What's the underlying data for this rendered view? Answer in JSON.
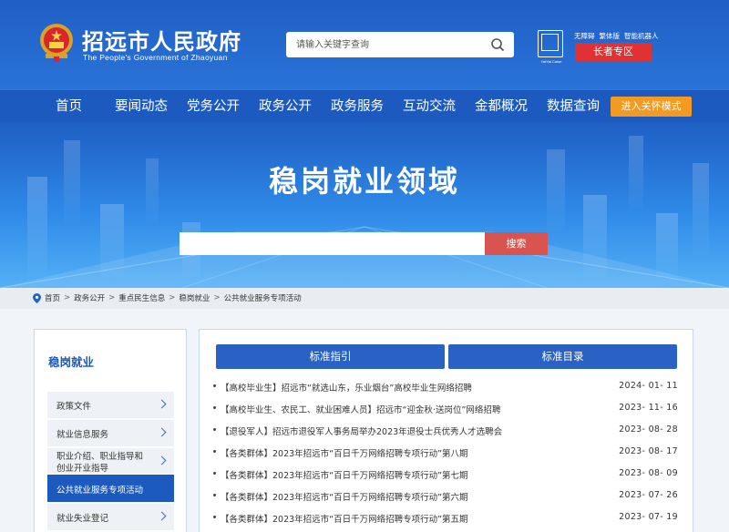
{
  "header": {
    "title": "招远市人民政府",
    "subtitle": "The People's Government of Zhaoyuan",
    "search_placeholder": "请输入关键字查询",
    "links": [
      "无障碍",
      "繁体版",
      "智能机器人"
    ],
    "elder_zone": "长者专区",
    "badge_caption": "YatYat Catse"
  },
  "nav": {
    "items": [
      "首页",
      "要闻动态",
      "党务公开",
      "政务公开",
      "政务服务",
      "互动交流",
      "金都概况",
      "数据查询"
    ],
    "care_mode": "进入关怀模式"
  },
  "banner": {
    "title": "稳岗就业领域",
    "search_button": "搜索"
  },
  "breadcrumb": [
    "首页",
    "政务公开",
    "重点民生信息",
    "稳岗就业",
    "公共就业服务专项活动"
  ],
  "sidebar": {
    "title": "稳岗就业",
    "items": [
      {
        "label": "政策文件"
      },
      {
        "label": "就业信息服务"
      },
      {
        "label": "职业介绍、职业指导和",
        "label2": "创业开业指导"
      },
      {
        "label": "公共就业服务专项活动"
      },
      {
        "label": "就业失业登记"
      }
    ]
  },
  "main": {
    "tabs": [
      "标准指引",
      "标准目录"
    ],
    "rows": [
      {
        "title": "【高校毕业生】招远市“就选山东，乐业烟台”高校毕业生网络招聘",
        "date": "2024- 01- 11"
      },
      {
        "title": "【高校毕业生、农民工、就业困难人员】招远市“迎金秋·送岗位”网络招聘",
        "date": "2023- 11- 16"
      },
      {
        "title": "【退役军人】招远市退役军人事务局举办2023年退役士兵优秀人才选聘会",
        "date": "2023- 08- 28"
      },
      {
        "title": "【各类群体】2023年招远市“百日千万网络招聘专项行动”第八期",
        "date": "2023- 08- 17"
      },
      {
        "title": "【各类群体】2023年招远市“百日千万网络招聘专项行动”第七期",
        "date": "2023- 08- 09"
      },
      {
        "title": "【各类群体】2023年招远市“百日千万网络招聘专项行动”第六期",
        "date": "2023- 07- 26"
      },
      {
        "title": "【各类群体】2023年招远市“百日千万网络招聘专项行动”第五期",
        "date": "2023- 07- 19"
      }
    ]
  },
  "colors": {
    "primary": "#1c5ac0",
    "accent_red": "#e03232",
    "accent_orange": "#f49a21"
  }
}
